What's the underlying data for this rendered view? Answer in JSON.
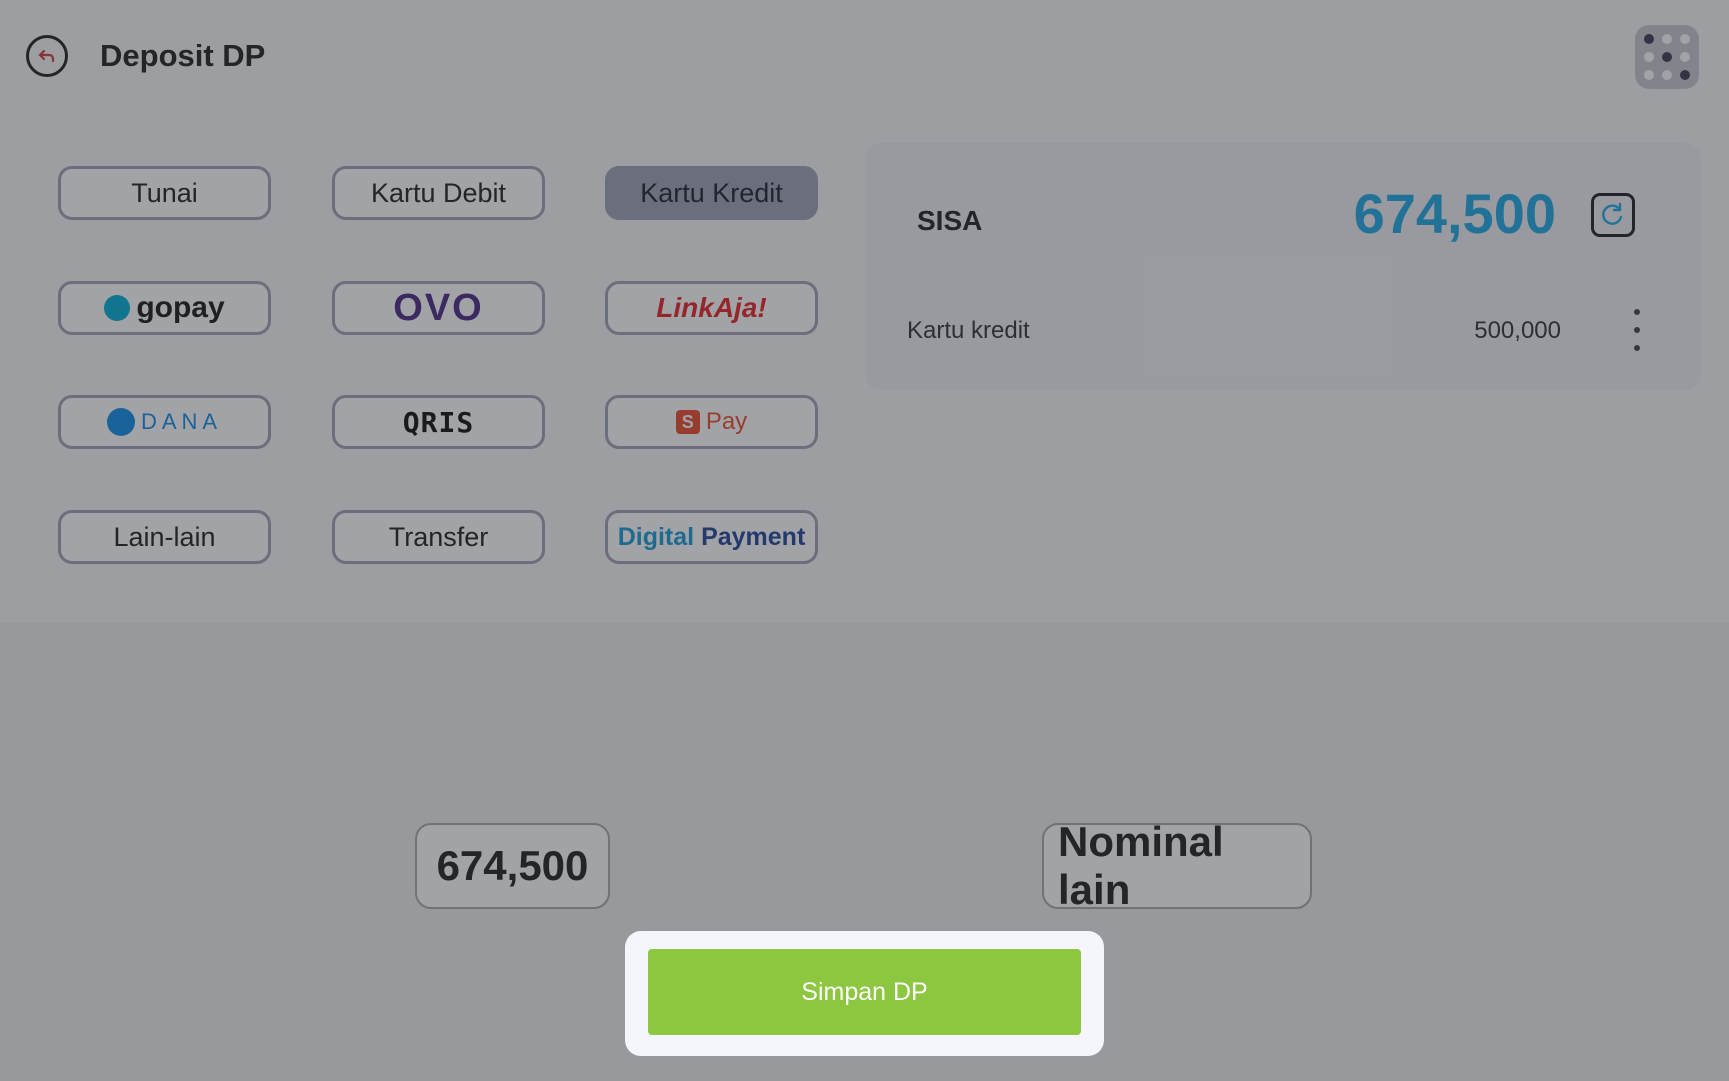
{
  "header": {
    "title": "Deposit DP",
    "back_icon": "back-arrow-circle-icon",
    "apps_icon": "grid-dots-icon"
  },
  "payment_methods": [
    {
      "label": "Tunai",
      "type": "text",
      "selected": false
    },
    {
      "label": "Kartu Debit",
      "type": "text",
      "selected": false
    },
    {
      "label": "Kartu Kredit",
      "type": "text",
      "selected": true
    },
    {
      "label": "gopay",
      "type": "logo"
    },
    {
      "label": "OVO",
      "type": "logo"
    },
    {
      "label": "LinkAja!",
      "type": "logo"
    },
    {
      "label": "DANA",
      "type": "logo"
    },
    {
      "label": "QRIS",
      "type": "logo"
    },
    {
      "label": "Pay",
      "type": "logo",
      "badge": "S"
    },
    {
      "label": "Lain-lain",
      "type": "text",
      "selected": false
    },
    {
      "label": "Transfer",
      "type": "text",
      "selected": false
    },
    {
      "label_a": "Digital",
      "label_b": "Payment",
      "type": "logo"
    }
  ],
  "summary": {
    "remaining_label": "SISA",
    "remaining_value": "674,500",
    "entries": [
      {
        "method": "Kartu kredit",
        "amount": "500,000"
      }
    ]
  },
  "quick_amounts": {
    "exact": "674,500",
    "other": "Nominal lain"
  },
  "save_button": {
    "label": "Simpan DP"
  },
  "colors": {
    "accent_blue": "#1ea9e6",
    "save_green": "#8dc63f",
    "selected_gray": "#9ea3b7"
  }
}
